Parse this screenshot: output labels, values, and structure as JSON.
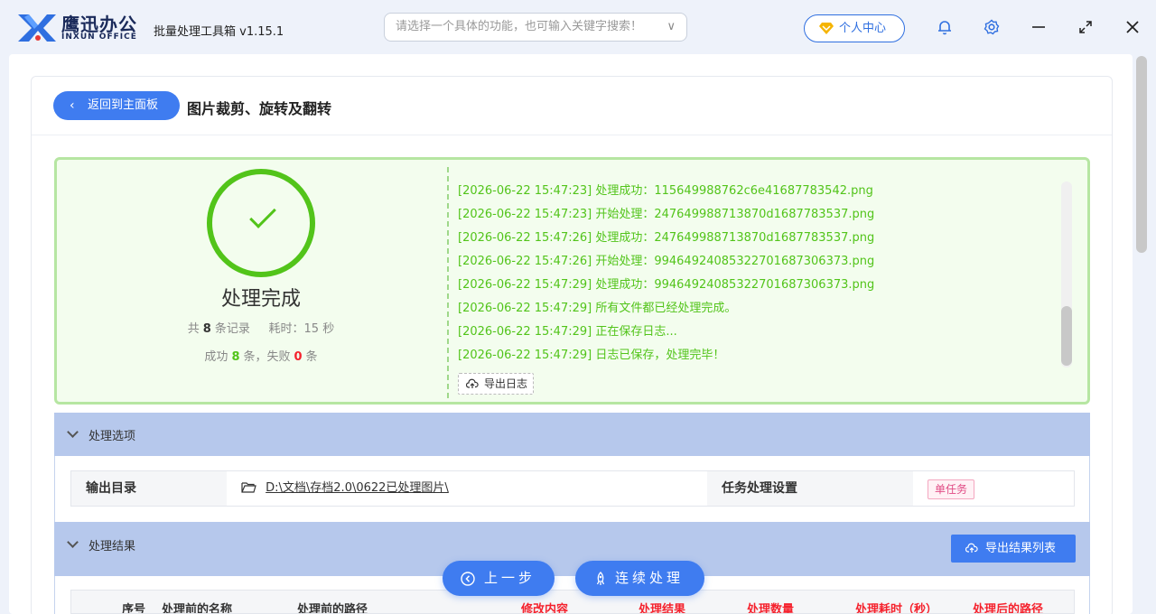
{
  "app": {
    "brand": "鹰迅办公",
    "brand_sub": "INXUN OFFICE",
    "name": "批量处理工具箱 v1.15.1"
  },
  "search": {
    "placeholder": "请选择一个具体的功能，也可输入关键字搜索！"
  },
  "header": {
    "user_center": "个人中心"
  },
  "page": {
    "back_label": "返回到主面板",
    "title": "图片裁剪、旋转及翻转"
  },
  "result": {
    "status": "处理完成",
    "total_prefix": "共",
    "total_count": "8",
    "total_suffix": "条记录",
    "time_prefix": "耗时：",
    "time_value": "15",
    "time_suffix": "秒",
    "success_prefix": "成功",
    "success_count": "8",
    "success_mid": "条，失败",
    "fail_count": "0",
    "fail_suffix": "条",
    "logs": [
      "[2026-06-22 15:47:23] 处理成功：115649988762c6e41687783542.png",
      "[2026-06-22 15:47:23] 开始处理：247649988713870d1687783537.png",
      "[2026-06-22 15:47:26] 处理成功：247649988713870d1687783537.png",
      "[2026-06-22 15:47:26] 开始处理：99464924085322701687306373.png",
      "[2026-06-22 15:47:29] 处理成功：99464924085322701687306373.png",
      "[2026-06-22 15:47:29] 所有文件都已经处理完成。",
      "[2026-06-22 15:47:29] 正在保存日志...",
      "[2026-06-22 15:47:29] 日志已保存，处理完毕！"
    ],
    "export_log": "导出日志"
  },
  "options": {
    "title": "处理选项",
    "output_label": "输出目录",
    "output_path": "D:\\文档\\存档2.0\\0622已处理图片\\",
    "task_label": "任务处理设置",
    "task_value": "单任务"
  },
  "results": {
    "title": "处理结果",
    "export_label": "导出结果列表",
    "columns": [
      "序号",
      "处理前的名称",
      "处理前的路径",
      "修改内容",
      "处理结果",
      "处理数量",
      "处理耗时（秒）",
      "处理后的路径"
    ]
  },
  "footer": {
    "prev": "上一步",
    "continue": "连续处理"
  },
  "colors": {
    "accent": "#3f7cf0",
    "success": "#52c41a",
    "fail": "#f5222d",
    "section": "#b6c8ec"
  }
}
